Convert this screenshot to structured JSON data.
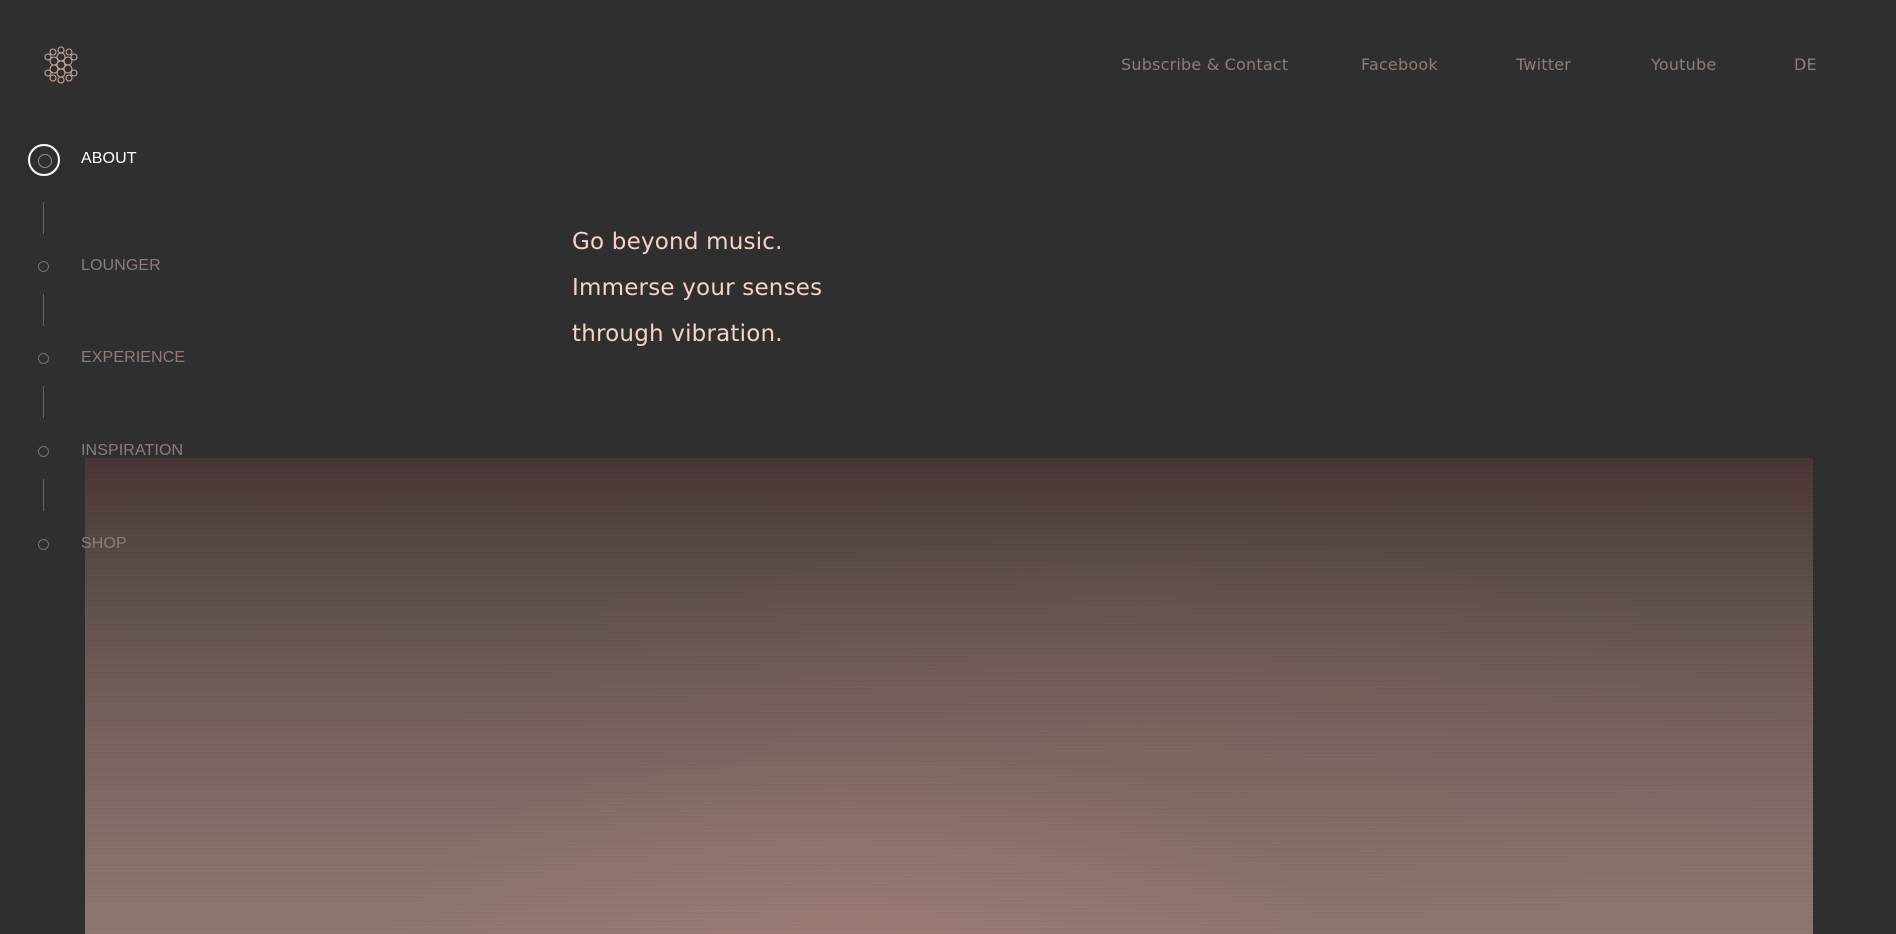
{
  "header": {
    "logo_icon": "vibration-flower-logo-icon",
    "nav": [
      {
        "label": "Subscribe & Contact"
      },
      {
        "label": "Facebook"
      },
      {
        "label": "Twitter"
      },
      {
        "label": "Youtube"
      },
      {
        "label": "DE"
      }
    ]
  },
  "sidebar": {
    "items": [
      {
        "label": "ABOUT",
        "active": true
      },
      {
        "label": "LOUNGER",
        "active": false
      },
      {
        "label": "EXPERIENCE",
        "active": false
      },
      {
        "label": "INSPIRATION",
        "active": false
      },
      {
        "label": "SHOP",
        "active": false
      }
    ]
  },
  "hero": {
    "lines": [
      "Go beyond music.",
      "Immerse your senses",
      "through vibration."
    ]
  },
  "colors": {
    "background": "#2f2f2f",
    "accent_text": "#f4d2c6",
    "muted_text": "#8c7d78",
    "active_text": "#ffffff"
  }
}
